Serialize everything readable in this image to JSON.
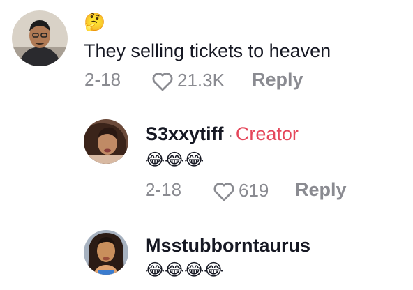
{
  "comments": [
    {
      "avatar_icon": "user-avatar-man-dark-shirt",
      "username": "",
      "text_emoji": "🤔",
      "text": "They selling tickets to heaven",
      "date": "2-18",
      "likes": "21.3K",
      "reply_label": "Reply"
    },
    {
      "avatar_icon": "user-avatar-woman",
      "username": "S3xxytiff",
      "separator": "·",
      "badge": "Creator",
      "text_emoji": "😂😂😂",
      "date": "2-18",
      "likes": "619",
      "reply_label": "Reply"
    },
    {
      "avatar_icon": "user-avatar-woman-long-hair",
      "username": "Msstubborntaurus",
      "text_emoji": "😂😂😂😂"
    }
  ],
  "colors": {
    "text": "#161823",
    "muted": "#8a8b91",
    "creator_accent": "#e5475b"
  },
  "icons": {
    "like": "heart-outline-icon"
  }
}
